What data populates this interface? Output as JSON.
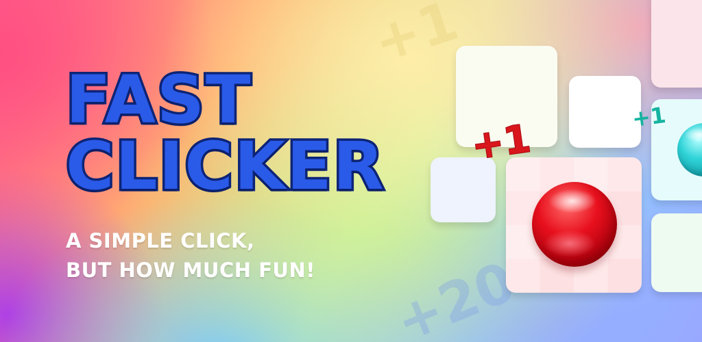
{
  "title": {
    "line1": "FAST",
    "line2": "CLICKER"
  },
  "tagline": {
    "line1": "A SIMPLE CLICK,",
    "line2": "BUT HOW MUCH FUN!"
  },
  "background_numbers": {
    "top": "+1",
    "bottom": "+20"
  },
  "score_popups": {
    "red": "+1",
    "teal": "+1"
  },
  "colors": {
    "title_fill": "#2a5ae8",
    "title_outline": "#0d2476",
    "tagline": "#ffffff",
    "red_ball": "#e8101d",
    "teal_ball": "#2fd3d8",
    "red_popup": "#d8161c",
    "teal_popup": "#15b3a0"
  },
  "icons": {
    "red_ball": "red-ball-icon",
    "teal_ball": "teal-ball-icon"
  }
}
